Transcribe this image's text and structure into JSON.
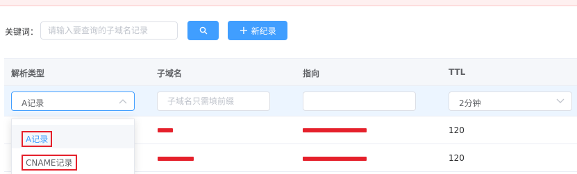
{
  "search": {
    "label": "关键词：",
    "placeholder": "请输入要查询的子域名记录",
    "add_button_label": "新纪录"
  },
  "table": {
    "headers": [
      "解析类型",
      "子域名",
      "指向",
      "TTL"
    ],
    "edit_row": {
      "type_value": "A记录",
      "subdomain_placeholder": "子域名只需填前缀",
      "target_value": "",
      "ttl_value": "2分钟"
    },
    "rows": [
      {
        "ttl": "120"
      },
      {
        "ttl": "120"
      }
    ]
  },
  "type_dropdown": {
    "options": [
      "A记录",
      "CNAME记录"
    ],
    "selected": "A记录"
  },
  "colors": {
    "primary": "#409eff",
    "highlight_row": "#ecf5ff",
    "redaction": "#e5202b",
    "alert_background": "#fef0f0"
  }
}
